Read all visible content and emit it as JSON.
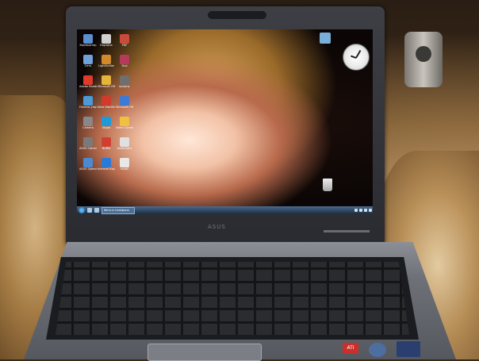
{
  "scene": {
    "brand": "ASUS",
    "desktop": {
      "icons": [
        {
          "label": "Компьютер"
        },
        {
          "label": "Корзина"
        },
        {
          "label": "PDF"
        },
        {
          "label": "Сеть"
        },
        {
          "label": "LightScribe"
        },
        {
          "label": "Dvd"
        },
        {
          "label": "Adobe Reader"
        },
        {
          "label": "Microsoft Office"
        },
        {
          "label": "проигр."
        },
        {
          "label": "Панель управления"
        },
        {
          "label": "Nero StartSmart"
        },
        {
          "label": "Microsoft Office"
        },
        {
          "label": "Camera"
        },
        {
          "label": "Skype"
        },
        {
          "label": "Video Converter"
        },
        {
          "label": "ASUS Camera"
        },
        {
          "label": "BURN"
        },
        {
          "label": "AudioConv"
        },
        {
          "label": "ASUS Splendid"
        },
        {
          "label": "Internet Explorer"
        },
        {
          "label": "Install"
        }
      ],
      "taskbar": {
        "task_label": "Фото в телефоне"
      }
    },
    "stickers": {
      "ati": "ATI"
    }
  }
}
